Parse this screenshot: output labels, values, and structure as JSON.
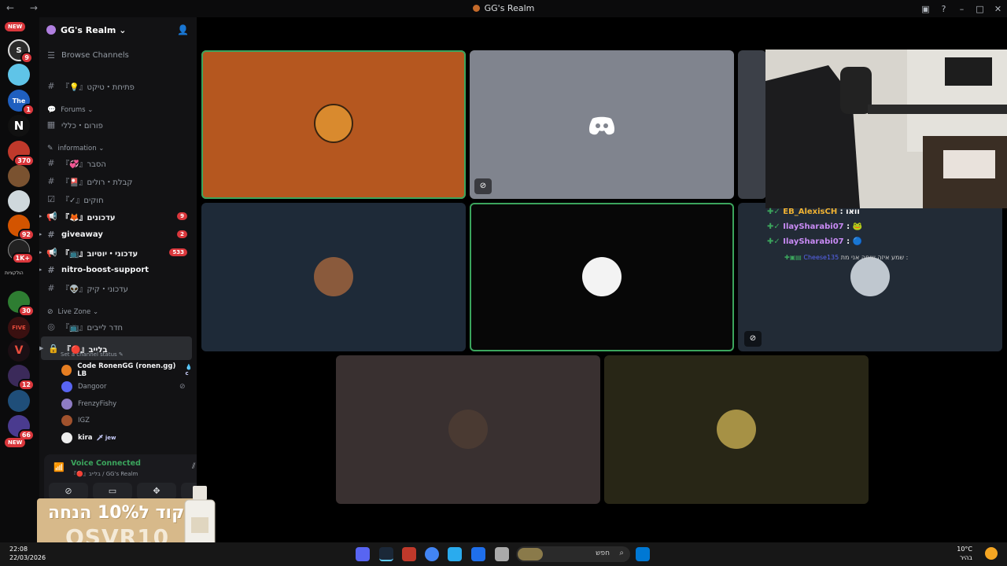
{
  "window": {
    "title": "GG's Realm"
  },
  "server_badges": {
    "new_top": "NEW",
    "new_bottom": "NEW",
    "s1": "9",
    "s3": "1",
    "s5": "370",
    "s8": "92",
    "s9": "1K+",
    "s11": "30",
    "s14": "12",
    "s16": "66",
    "side_label": "הולקציות"
  },
  "guild": {
    "name": "GG's Realm ⌄"
  },
  "sidebar": {
    "browse": "Browse Channels",
    "ticket": "『💡』פתיחת・טיקט",
    "forums_cat": "Forums ⌄",
    "forum_general": "פורום・כללי",
    "information_cat": "information ⌄",
    "explain": "『💞』הסבר",
    "roles": "『🎴』קבלת・רולים",
    "rules": "『✓』חוקים",
    "updates": "『🦊』עדכונים",
    "updates_count": "9",
    "giveaway": "giveaway",
    "giveaway_count": "2",
    "youtube": "『📺』עדכוני・יוטיוב",
    "youtube_count": "533",
    "nitro": "nitro-boost-support",
    "kick": "『👽』עדכוני・קיק",
    "live_cat": "Live Zone ⌄",
    "live_room": "『📺』חדר לייבים",
    "live_channel": "『🔴』בלייב",
    "status_hint": "Set a channel status ✎"
  },
  "members": [
    {
      "name": "Code RonenGG (ronen.gg) LB",
      "tag": "💧 c"
    },
    {
      "name": "Dangoor",
      "tag": ""
    },
    {
      "name": "FrenzyFishy",
      "tag": ""
    },
    {
      "name": "IGZ",
      "tag": ""
    },
    {
      "name": "kira",
      "tag": "🗡 jew"
    }
  ],
  "voice": {
    "status": "Voice Connected",
    "channel": "『🔴』בלייב / GG's Realm"
  },
  "ad": {
    "line1": "קוד ל10% הנחה",
    "line2": "OSVR10"
  },
  "chat": [
    {
      "user": "EB_AlexisCH",
      "msg": " : וואו",
      "color": "#f0b232"
    },
    {
      "user": "IlaySharabi07",
      "msg": " : 🐸",
      "color": "#c98bf5"
    },
    {
      "user": "IlaySharabi07",
      "msg": " : 🔵",
      "color": "#c98bf5"
    },
    {
      "user": "Cheese135",
      "msg": " שמע איזה שיחה אני מת :",
      "color": "#5865f2"
    }
  ],
  "taskbar": {
    "time": "22:08",
    "date": "22/03/2026",
    "search": "חפש",
    "temp": "10°C",
    "weather": "בהיר"
  },
  "colors": {
    "accent_green": "#3ba55d",
    "badge_red": "#da373c",
    "tile_orange": "#b5571f"
  }
}
